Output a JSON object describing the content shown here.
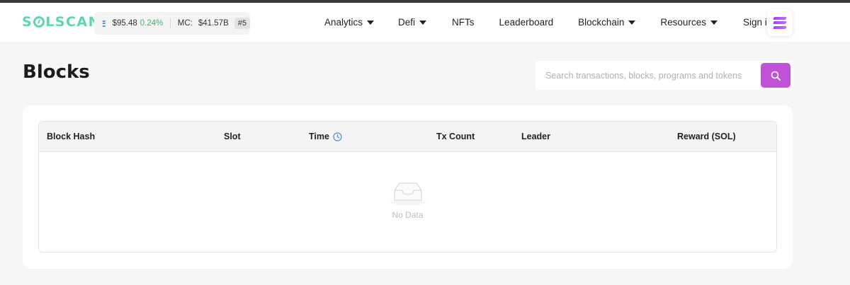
{
  "header": {
    "logo_left": "S",
    "logo_right": "LSCAN",
    "price": "$95.48",
    "price_change": "0.24%",
    "mc_label": "MC:",
    "mc_value": "$41.57B",
    "rank": "#5",
    "nav": [
      {
        "label": "Analytics",
        "dropdown": true
      },
      {
        "label": "Defi",
        "dropdown": true
      },
      {
        "label": "NFTs",
        "dropdown": false
      },
      {
        "label": "Leaderboard",
        "dropdown": false
      },
      {
        "label": "Blockchain",
        "dropdown": true
      },
      {
        "label": "Resources",
        "dropdown": true
      },
      {
        "label": "Sign in",
        "dropdown": false
      }
    ]
  },
  "page": {
    "title": "Blocks"
  },
  "search": {
    "placeholder": "Search transactions, blocks, programs and tokens",
    "value": ""
  },
  "table": {
    "columns": [
      "Block Hash",
      "Slot",
      "Time",
      "Tx Count",
      "Leader",
      "Reward (SOL)"
    ],
    "rows": [],
    "empty_text": "No Data"
  },
  "colors": {
    "brand": "#5fd4b3",
    "accent": "#c052d8",
    "positive": "#3cb66b"
  },
  "icons": {
    "menu": "solana-menu-icon",
    "search": "search-icon",
    "time": "clock-icon",
    "empty": "empty-inbox-icon"
  }
}
